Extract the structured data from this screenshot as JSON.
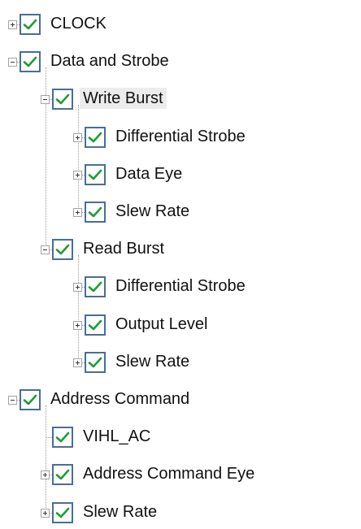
{
  "tree": {
    "colors": {
      "check": "#1e9e34",
      "checkbox_border": "#4a6d9a",
      "connector": "#9a9a9a",
      "selected_background": "#ececec"
    },
    "nodes": [
      {
        "label": "CLOCK",
        "depth": 0,
        "state": "collapsed",
        "checked": true,
        "selected": false
      },
      {
        "label": "Data and Strobe",
        "depth": 0,
        "state": "expanded",
        "checked": true,
        "selected": false
      },
      {
        "label": "Write Burst",
        "depth": 1,
        "state": "expanded",
        "checked": true,
        "selected": true
      },
      {
        "label": "Differential Strobe",
        "depth": 2,
        "state": "collapsed",
        "checked": true,
        "selected": false
      },
      {
        "label": "Data Eye",
        "depth": 2,
        "state": "collapsed",
        "checked": true,
        "selected": false
      },
      {
        "label": "Slew Rate",
        "depth": 2,
        "state": "collapsed",
        "checked": true,
        "selected": false
      },
      {
        "label": "Read Burst",
        "depth": 1,
        "state": "expanded",
        "checked": true,
        "selected": false
      },
      {
        "label": "Differential Strobe",
        "depth": 2,
        "state": "collapsed",
        "checked": true,
        "selected": false
      },
      {
        "label": "Output Level",
        "depth": 2,
        "state": "collapsed",
        "checked": true,
        "selected": false
      },
      {
        "label": "Slew Rate",
        "depth": 2,
        "state": "collapsed",
        "checked": true,
        "selected": false
      },
      {
        "label": "Address Command",
        "depth": 0,
        "state": "expanded",
        "checked": true,
        "selected": false
      },
      {
        "label": "VIHL_AC",
        "depth": 1,
        "state": "leaf",
        "checked": true,
        "selected": false
      },
      {
        "label": "Address Command Eye",
        "depth": 1,
        "state": "collapsed",
        "checked": true,
        "selected": false
      },
      {
        "label": "Slew Rate",
        "depth": 1,
        "state": "collapsed",
        "checked": true,
        "selected": false
      }
    ]
  }
}
